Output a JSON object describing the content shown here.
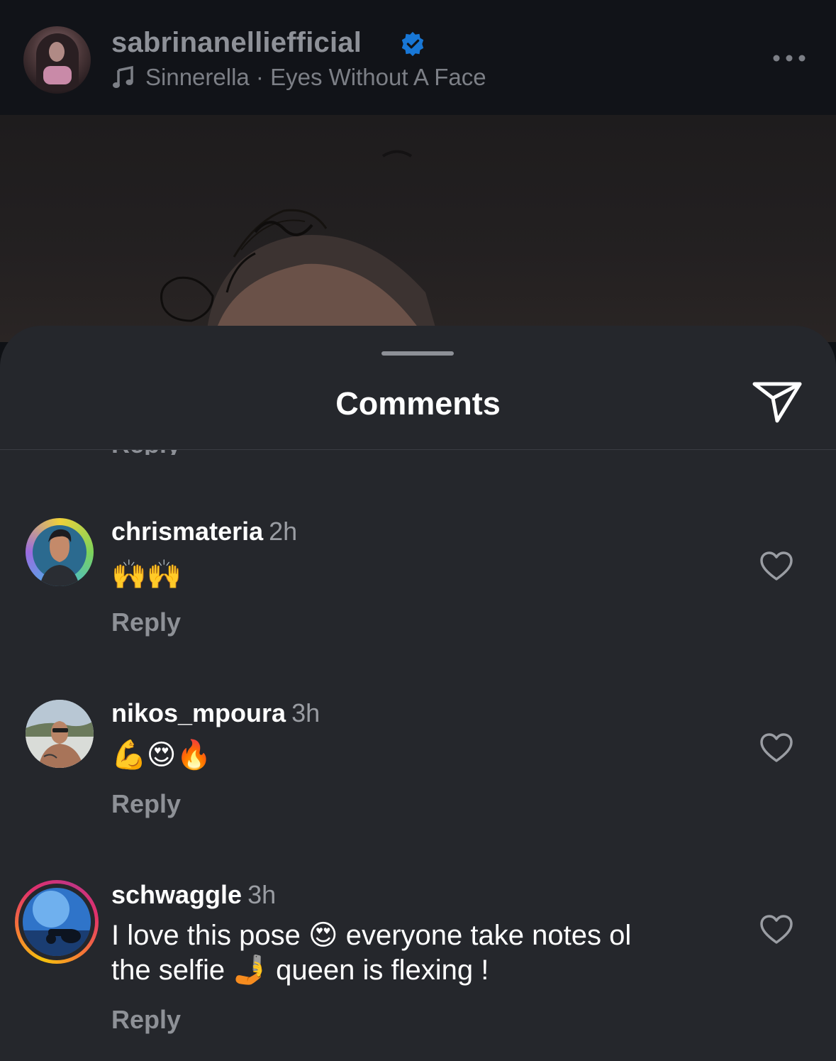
{
  "post": {
    "username": "sabrinanelliefficial",
    "track": "Sinnerella · Eyes Without A Face"
  },
  "sheet": {
    "title": "Comments",
    "cut_off_text": "Reply"
  },
  "comments": [
    {
      "username": "chrismateria",
      "time": "2h",
      "text": "🙌🙌",
      "reply_label": "Reply"
    },
    {
      "username": "nikos_mpoura",
      "time": "3h",
      "text": "💪😍🔥",
      "reply_label": "Reply"
    },
    {
      "username": "schwaggle",
      "time": "3h",
      "text_line1": "I love this pose 😍 everyone take notes ol",
      "text_line2": "the selfie 🤳 queen is flexing !",
      "reply_label": "Reply"
    }
  ],
  "icons": {
    "verified": "verified-badge-icon",
    "music": "music-note-icon",
    "more": "more-options-icon",
    "share": "send-icon",
    "like": "heart-icon"
  },
  "colors": {
    "sheet_bg": "#25272c",
    "verified_blue": "#1877d6",
    "story_ring_start": "#f4c20d",
    "story_ring_end": "#e1306c"
  }
}
